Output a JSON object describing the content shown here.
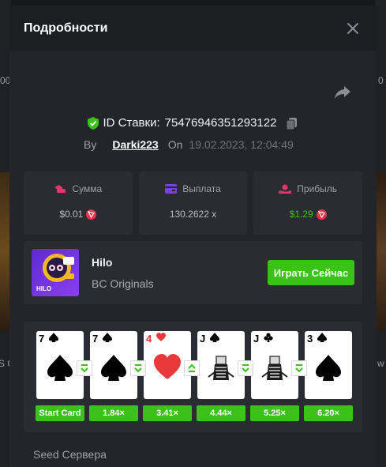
{
  "modal": {
    "title": "Подробности",
    "close_icon": "close-icon",
    "share_icon": "share-icon"
  },
  "bet": {
    "id_label": "ID Ставки:",
    "id_value": "75476946351293122",
    "by_label": "By",
    "user": "Darki223",
    "on_label": "On",
    "date": "19.02.2023, 12:04:49"
  },
  "stats": [
    {
      "icon": "wager-icon",
      "label": "Сумма",
      "value": "$0.01",
      "currency_icon": "trx-icon",
      "color": "#e8336b"
    },
    {
      "icon": "wallet-icon",
      "label": "Выплата",
      "value": "130.2622 x",
      "currency_icon": "",
      "color": "#7b3fe4"
    },
    {
      "icon": "profit-icon",
      "label": "Прибыль",
      "value": "$1.29",
      "currency_icon": "trx-icon",
      "color": "#e8336b"
    }
  ],
  "game": {
    "name": "Hilo",
    "provider": "BC Originals",
    "thumb_label": "HILO",
    "play_label": "Играть Сейчас"
  },
  "cards": [
    {
      "rank": "7",
      "suit": "spade",
      "color": "#000000",
      "mult": "Start Card",
      "arrow": "down"
    },
    {
      "rank": "7",
      "suit": "spade",
      "color": "#000000",
      "mult": "1.84×",
      "arrow": "down"
    },
    {
      "rank": "4",
      "suit": "heart",
      "color": "#e8393b",
      "mult": "3.41×",
      "arrow": "up"
    },
    {
      "rank": "J",
      "suit": "spade",
      "color": "#000000",
      "mult": "4.44×",
      "arrow": "down"
    },
    {
      "rank": "J",
      "suit": "club",
      "color": "#000000",
      "mult": "5.25×",
      "arrow": "down"
    },
    {
      "rank": "3",
      "suit": "spade",
      "color": "#000000",
      "mult": "6.20×",
      "arrow": ""
    }
  ],
  "seed": {
    "label": "Seed Сервера"
  },
  "background": {
    "left_text_1": "00",
    "left_text_2": "0",
    "left_text_3": "S C",
    "right_text_1": "w"
  },
  "colors": {
    "accent_green": "#3bc117",
    "panel": "#2a2c32",
    "body": "#23252a"
  }
}
